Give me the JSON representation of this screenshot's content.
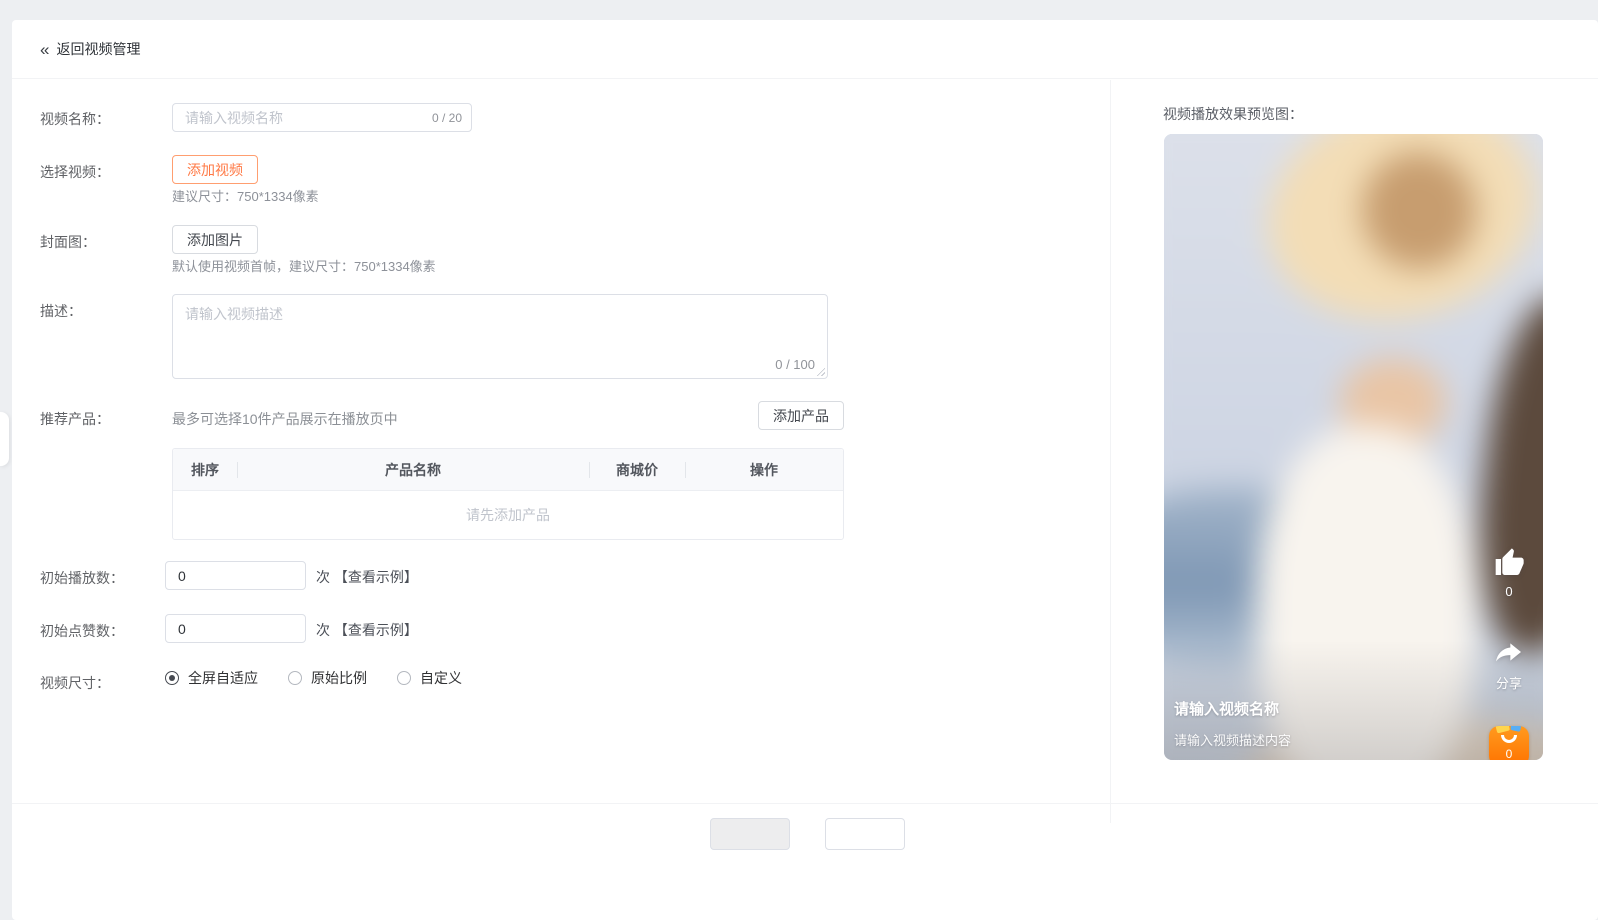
{
  "page": {
    "back_icon": "«",
    "back_label": "返回视频管理"
  },
  "form": {
    "video_name": {
      "label": "视频名称：",
      "placeholder": "请输入视频名称",
      "counter": "0 / 20"
    },
    "select_video": {
      "label": "选择视频：",
      "button": "添加视频",
      "hint": "建议尺寸：750*1334像素"
    },
    "cover": {
      "label": "封面图：",
      "button": "添加图片",
      "hint": "默认使用视频首帧，建议尺寸：750*1334像素"
    },
    "description": {
      "label": "描述：",
      "placeholder": "请输入视频描述",
      "counter": "0 / 100"
    },
    "products": {
      "label": "推荐产品：",
      "hint": "最多可选择10件产品展示在播放页中",
      "add_button": "添加产品",
      "table": {
        "headers": [
          "排序",
          "产品名称",
          "商城价",
          "操作"
        ],
        "rows": [],
        "empty": "请先添加产品"
      }
    },
    "initial_plays": {
      "label": "初始播放数：",
      "value": "0",
      "suffix": "次",
      "example_link": "【查看示例】"
    },
    "initial_likes": {
      "label": "初始点赞数：",
      "value": "0",
      "suffix": "次",
      "example_link": "【查看示例】"
    },
    "video_size": {
      "label": "视频尺寸：",
      "options": [
        {
          "label": "全屏自适应",
          "selected": true
        },
        {
          "label": "原始比例",
          "selected": false
        },
        {
          "label": "自定义",
          "selected": false
        }
      ]
    }
  },
  "preview": {
    "title": "视频播放效果预览图：",
    "like_count": "0",
    "share_label": "分享",
    "cart_count": "0",
    "overlay_title": "请输入视频名称",
    "overlay_desc": "请输入视频描述内容"
  },
  "colors": {
    "accent_orange": "#ff7945",
    "bag_orange": "#ff8a00",
    "text_primary": "#303133",
    "text_secondary": "#606266",
    "placeholder": "#c0c4cc"
  }
}
